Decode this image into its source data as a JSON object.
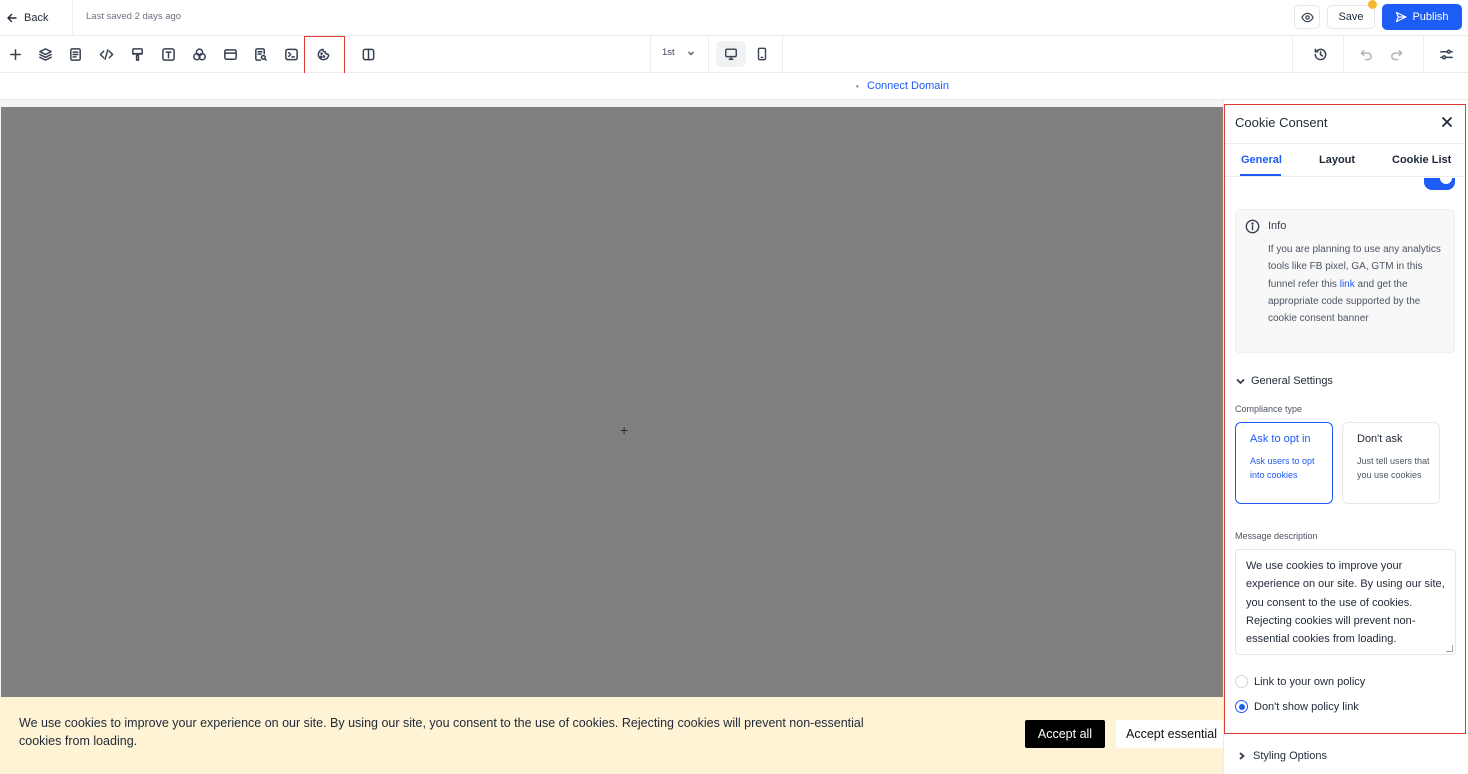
{
  "topbar": {
    "back_label": "Back",
    "last_saved": "Last saved 2 days ago",
    "save_label": "Save",
    "publish_label": "Publish"
  },
  "toolbar": {
    "tools": [
      "plus-icon",
      "layers-icon",
      "page-icon",
      "code-icon",
      "paint-brush-icon",
      "text-icon",
      "color-palette-icon",
      "section-icon",
      "search-file-icon",
      "terminal-icon",
      "cookie-icon",
      "split-view-icon"
    ],
    "active_tool": "cookie-icon",
    "page_selector": "1st",
    "devices": [
      "desktop-icon",
      "mobile-icon"
    ],
    "right_tools": [
      "history-icon",
      "undo-icon",
      "redo-icon",
      "settings-sliders-icon"
    ]
  },
  "domain_bar": {
    "connect_domain": "Connect Domain"
  },
  "banner": {
    "text": "We use cookies to improve your experience on our site. By using our site, you consent to the use of cookies. Rejecting cookies will prevent non-essential cookies from loading.",
    "accept_all": "Accept all",
    "accept_essential": "Accept essential"
  },
  "panel": {
    "title": "Cookie Consent",
    "tabs": [
      {
        "label": "General",
        "active": true
      },
      {
        "label": "Layout",
        "active": false
      },
      {
        "label": "Cookie List",
        "active": false
      }
    ],
    "info": {
      "title": "Info",
      "text_before": "If you are planning to use any analytics tools like FB pixel, GA, GTM in this funnel refer this ",
      "link": "link",
      "text_after": " and get the appropriate code supported by the cookie consent banner"
    },
    "general_settings": "General Settings",
    "compliance_label": "Compliance type",
    "options": [
      {
        "title": "Ask to opt in",
        "desc": "Ask users to opt into cookies",
        "selected": true
      },
      {
        "title": "Don't ask",
        "desc": "Just tell users that you use cookies",
        "selected": false
      }
    ],
    "message_label": "Message description",
    "message_text": "We use cookies to improve your experience on our site. By using our site, you consent to the use of cookies. Rejecting cookies will prevent non-essential cookies from loading.",
    "policy_options": [
      {
        "label": "Link to your own policy",
        "checked": false
      },
      {
        "label": "Don't show policy link",
        "checked": true
      }
    ],
    "styling_options": "Styling Options"
  },
  "colors": {
    "accent": "#1d5cf5",
    "highlight_outline": "#e53935",
    "banner_bg": "#fef3d4",
    "canvas": "#808080"
  }
}
